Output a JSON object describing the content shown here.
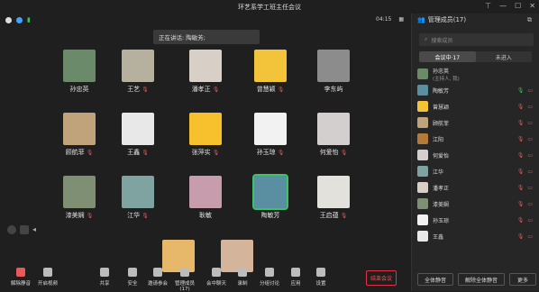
{
  "title": "环艺系学工班主任会议",
  "clock": "04:15",
  "speaking": "正在讲话: 陶敏芳;",
  "colors": {
    "bg": "#1f1f1f",
    "accent_red": "#e85a5a",
    "active_border": "#3cc36a"
  },
  "participants": [
    {
      "name": "孙忠英",
      "muted": false,
      "avatar": "#6b8a6a"
    },
    {
      "name": "王艺",
      "muted": true,
      "avatar": "#b6b09e"
    },
    {
      "name": "潘孝正",
      "muted": true,
      "avatar": "#d8cfc7"
    },
    {
      "name": "曾慧颖",
      "muted": true,
      "avatar": "#f3c33a"
    },
    {
      "name": "李东屿",
      "muted": false,
      "avatar": "#8c8c8c"
    },
    {
      "name": "顾航菲",
      "muted": true,
      "avatar": "#c0a37a"
    },
    {
      "name": "王鑫",
      "muted": true,
      "avatar": "#e8e8e8"
    },
    {
      "name": "张萍实",
      "muted": true,
      "avatar": "#f6c12c"
    },
    {
      "name": "孙玉琼",
      "muted": true,
      "avatar": "#f2f2f2"
    },
    {
      "name": "何爱怡",
      "muted": true,
      "avatar": "#d4cfcf"
    },
    {
      "name": "漆美娴",
      "muted": true,
      "avatar": "#7f8f73"
    },
    {
      "name": "江华",
      "muted": true,
      "avatar": "#7fa3a0"
    },
    {
      "name": "耿敏",
      "muted": false,
      "avatar": "#c79dad"
    },
    {
      "name": "陶敏芳",
      "muted": false,
      "avatar": "#5a8fa2"
    },
    {
      "name": "王启蕴",
      "muted": true,
      "avatar": "#e2e1dc"
    }
  ],
  "toolbar": {
    "items": [
      "解除静音",
      "开启视频",
      "共享",
      "安全",
      "邀请参会",
      "管理成员(17)",
      "会中聊天",
      "录制",
      "分组讨论",
      "应用",
      "设置"
    ],
    "end": "结束会议"
  },
  "side": {
    "title": "管理成员(17)",
    "search_placeholder": "搜索成员",
    "tab_in": "会议中·17",
    "tab_waiting": "未进入",
    "members": [
      {
        "name": "孙忠英",
        "sub": "(主持人, 我)",
        "avatar": "#6b8a6a"
      },
      {
        "name": "陶敏芳",
        "sub": "",
        "avatar": "#5a8fa2"
      },
      {
        "name": "曾慧颖",
        "sub": "",
        "avatar": "#f3c33a"
      },
      {
        "name": "顾航菲",
        "sub": "",
        "avatar": "#c0a37a"
      },
      {
        "name": "江阳",
        "sub": "",
        "avatar": "#b47a3a"
      },
      {
        "name": "何爱怡",
        "sub": "",
        "avatar": "#d4cfcf"
      },
      {
        "name": "江华",
        "sub": "",
        "avatar": "#7fa3a0"
      },
      {
        "name": "潘孝正",
        "sub": "",
        "avatar": "#d8cfc7"
      },
      {
        "name": "漆美娴",
        "sub": "",
        "avatar": "#7f8f73"
      },
      {
        "name": "孙玉琼",
        "sub": "",
        "avatar": "#f2f2f2"
      },
      {
        "name": "王鑫",
        "sub": "",
        "avatar": "#e8e8e8"
      }
    ],
    "mute_all": "全体静音",
    "unmute_all": "解除全体静音",
    "more": "更多"
  }
}
